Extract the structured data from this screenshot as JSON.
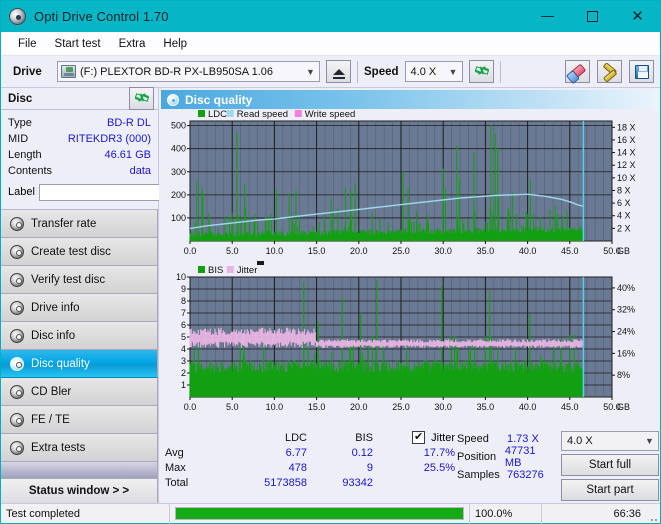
{
  "window": {
    "title": "Opti Drive Control 1.70",
    "icon": "disc-icon",
    "minimize": "–",
    "maximize": "□",
    "close": "✕"
  },
  "menu": {
    "items": [
      "File",
      "Start test",
      "Extra",
      "Help"
    ]
  },
  "toolbar": {
    "drive_label": "Drive",
    "drive_value": "(F:)  PLEXTOR BD-R  PX-LB950SA 1.06",
    "eject_label": "eject-button",
    "speed_label": "Speed",
    "speed_value": "4.0 X",
    "refresh_label": "refresh-button",
    "erase_label": "erase-button",
    "tools_label": "tools-button",
    "save_label": "save-button"
  },
  "disc_panel": {
    "header": "Disc",
    "refresh_label": "refresh-disc-button",
    "rows": [
      {
        "key": "Type",
        "value": "BD-R DL"
      },
      {
        "key": "MID",
        "value": "RITEKDR3 (000)"
      },
      {
        "key": "Length",
        "value": "46.61 GB"
      },
      {
        "key": "Contents",
        "value": "data"
      }
    ],
    "label_key": "Label",
    "label_value": "",
    "label_placeholder": ""
  },
  "sidebar": {
    "items": [
      {
        "label": "Transfer rate",
        "active": false
      },
      {
        "label": "Create test disc",
        "active": false
      },
      {
        "label": "Verify test disc",
        "active": false
      },
      {
        "label": "Drive info",
        "active": false
      },
      {
        "label": "Disc info",
        "active": false
      },
      {
        "label": "Disc quality",
        "active": true
      },
      {
        "label": "CD Bler",
        "active": false
      },
      {
        "label": "FE / TE",
        "active": false
      },
      {
        "label": "Extra tests",
        "active": false
      }
    ],
    "status_window": "Status window > >"
  },
  "main": {
    "panel_title": "Disc quality"
  },
  "stats": {
    "headers": [
      "",
      "LDC",
      "BIS",
      "Jitter"
    ],
    "jitter_checked": true,
    "jitter_check_glyph": "✔",
    "rows": [
      {
        "label": "Avg",
        "ldc": "6.77",
        "bis": "0.12",
        "jitter": "17.7%"
      },
      {
        "label": "Max",
        "ldc": "478",
        "bis": "9",
        "jitter": "25.5%"
      },
      {
        "label": "Total",
        "ldc": "5173858",
        "bis": "93342",
        "jitter": ""
      }
    ]
  },
  "controls": {
    "speed_label": "Speed",
    "speed_value": "1.73 X",
    "position_label": "Position",
    "position_value": "47731 MB",
    "samples_label": "Samples",
    "samples_value": "763276",
    "speed_select": "4.0 X",
    "start_full": "Start full",
    "start_part": "Start part"
  },
  "statusbar": {
    "message": "Test completed",
    "progress_percent": 100.0,
    "progress_text": "100.0%",
    "elapsed": "66:36"
  },
  "colors": {
    "titlebar": "#06b6c6",
    "accent": "#00a7e6",
    "ldc": "#12a012",
    "read_speed": "#9fd8f0",
    "write_speed": "#f47de0",
    "bis": "#12a012",
    "jitter": "#e6b4e0",
    "plot_bg": "#6b7a94",
    "value_text": "#1918cf",
    "progress": "#13aa13"
  },
  "chart_data": [
    {
      "type": "line",
      "id": "top-chart",
      "title": "",
      "legend": [
        {
          "label": "LDC",
          "color": "#12a012"
        },
        {
          "label": "Read speed",
          "color": "#9fd8f0"
        },
        {
          "label": "Write speed",
          "color": "#f47de0"
        }
      ],
      "legend_position": "top-left",
      "xlabel": "GB",
      "x_ticks": [
        "0.0",
        "5.0",
        "10.0",
        "15.0",
        "20.0",
        "25.0",
        "30.0",
        "35.0",
        "40.0",
        "45.0",
        "50.0"
      ],
      "xlim": [
        0,
        50
      ],
      "ylabel": "",
      "y_ticks": [
        "100",
        "200",
        "300",
        "400",
        "500"
      ],
      "ylim": [
        0,
        520
      ],
      "y2_ticks": [
        "2 X",
        "4 X",
        "6 X",
        "8 X",
        "10 X",
        "12 X",
        "14 X",
        "16 X",
        "18 X"
      ],
      "y2lim": [
        0,
        19
      ],
      "grid": true,
      "series": [
        {
          "name": "Read speed",
          "color": "#9fd8f0",
          "x": [
            0,
            2,
            4,
            6,
            8,
            10,
            12,
            14,
            16,
            18,
            20,
            22,
            24,
            26,
            28,
            30,
            32,
            34,
            36,
            38,
            40,
            42,
            44,
            45,
            46,
            46.6
          ],
          "y": [
            2.0,
            2.4,
            2.7,
            3.0,
            3.3,
            3.5,
            3.8,
            4.1,
            4.4,
            4.7,
            5.0,
            5.3,
            5.6,
            5.9,
            6.2,
            6.5,
            6.8,
            7.0,
            7.2,
            7.3,
            7.4,
            7.1,
            6.6,
            6.2,
            5.7,
            5.5
          ]
        },
        {
          "name": "LDC",
          "color": "#12a012",
          "note": "dense error spikes, baseline ~20-60, peaks to 478",
          "avg": 6.77,
          "max": 478,
          "total": 5173858
        }
      ],
      "markers": [
        {
          "type": "vline",
          "x": 46.61,
          "color": "#4fd2ef",
          "label": "disc-end"
        }
      ]
    },
    {
      "type": "line",
      "id": "bottom-chart",
      "title": "",
      "legend": [
        {
          "label": "BIS",
          "color": "#12a012"
        },
        {
          "label": "Jitter",
          "color": "#e6b4e0"
        }
      ],
      "legend_position": "top-left",
      "xlabel": "GB",
      "x_ticks": [
        "0.0",
        "5.0",
        "10.0",
        "15.0",
        "20.0",
        "25.0",
        "30.0",
        "35.0",
        "40.0",
        "45.0",
        "50.0"
      ],
      "xlim": [
        0,
        50
      ],
      "ylabel": "",
      "y_ticks": [
        "1",
        "2",
        "3",
        "4",
        "5",
        "6",
        "7",
        "8",
        "9",
        "10"
      ],
      "ylim": [
        0,
        10
      ],
      "y2_ticks": [
        "8%",
        "16%",
        "24%",
        "32%",
        "40%"
      ],
      "y2lim": [
        0,
        44
      ],
      "grid": true,
      "series": [
        {
          "name": "BIS",
          "color": "#12a012",
          "note": "dense baseline ~2-3 with spikes to 9",
          "avg": 0.12,
          "max": 9,
          "total": 93342
        },
        {
          "name": "Jitter",
          "color": "#e6b4e0",
          "note": "band between ~16% and ~24%, avg 17.7%, max 25.5%",
          "avg_pct": 17.7,
          "max_pct": 25.5
        }
      ],
      "markers": [
        {
          "type": "vline",
          "x": 46.61,
          "color": "#4fd2ef",
          "label": "disc-end"
        }
      ]
    }
  ]
}
